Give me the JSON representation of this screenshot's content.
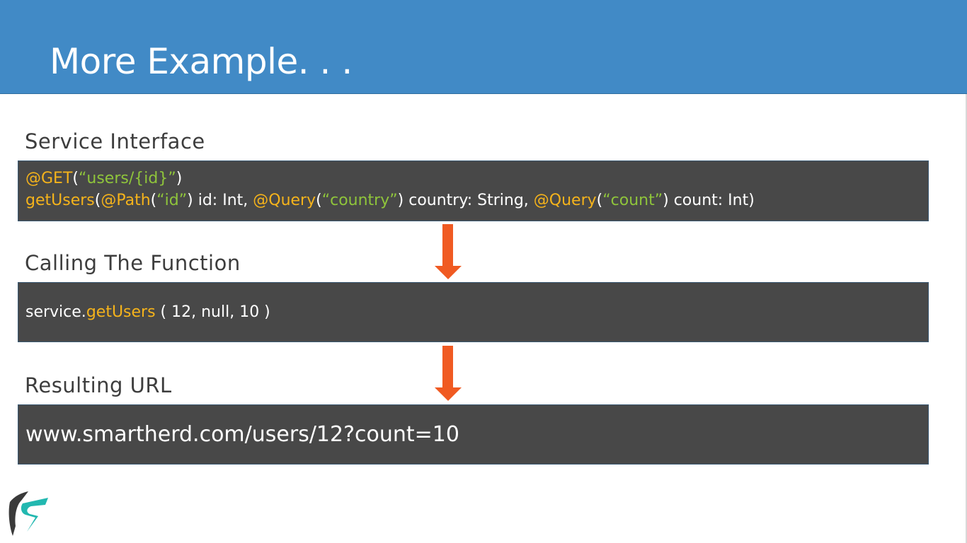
{
  "slide": {
    "title": "More Example. . ."
  },
  "sections": {
    "interface": {
      "heading": "Service Interface",
      "line1": [
        {
          "t": "@GET",
          "k": "ann"
        },
        {
          "t": "(",
          "k": "plain"
        },
        {
          "t": "“users/{id}”",
          "k": "str"
        },
        {
          "t": ")",
          "k": "plain"
        }
      ],
      "line2": [
        {
          "t": "getUsers",
          "k": "ann"
        },
        {
          "t": "(",
          "k": "plain"
        },
        {
          "t": "@Path",
          "k": "ann"
        },
        {
          "t": "(",
          "k": "plain"
        },
        {
          "t": "“id”",
          "k": "str"
        },
        {
          "t": ") id: Int, ",
          "k": "plain"
        },
        {
          "t": "@Query",
          "k": "ann"
        },
        {
          "t": "(",
          "k": "plain"
        },
        {
          "t": "“country”",
          "k": "str"
        },
        {
          "t": ") country: String, ",
          "k": "plain"
        },
        {
          "t": "@Query",
          "k": "ann"
        },
        {
          "t": "(",
          "k": "plain"
        },
        {
          "t": "“count”",
          "k": "str"
        },
        {
          "t": ") count: Int)",
          "k": "plain"
        }
      ]
    },
    "calling": {
      "heading": "Calling The Function",
      "line": [
        {
          "t": "service.",
          "k": "plain"
        },
        {
          "t": "getUsers",
          "k": "ann"
        },
        {
          "t": " ( 12, null, 10 )",
          "k": "plain"
        }
      ]
    },
    "result": {
      "heading": "Resulting URL",
      "url": "www.smartherd.com/users/12?count=10"
    }
  },
  "colors": {
    "header_bg": "#418ac6",
    "code_bg": "#484848",
    "annotation": "#f5b31b",
    "string": "#8fc53b",
    "arrow": "#f05a22"
  },
  "icons": {
    "arrow": "arrow-down-icon",
    "logo": "smartherd-logo-icon"
  }
}
